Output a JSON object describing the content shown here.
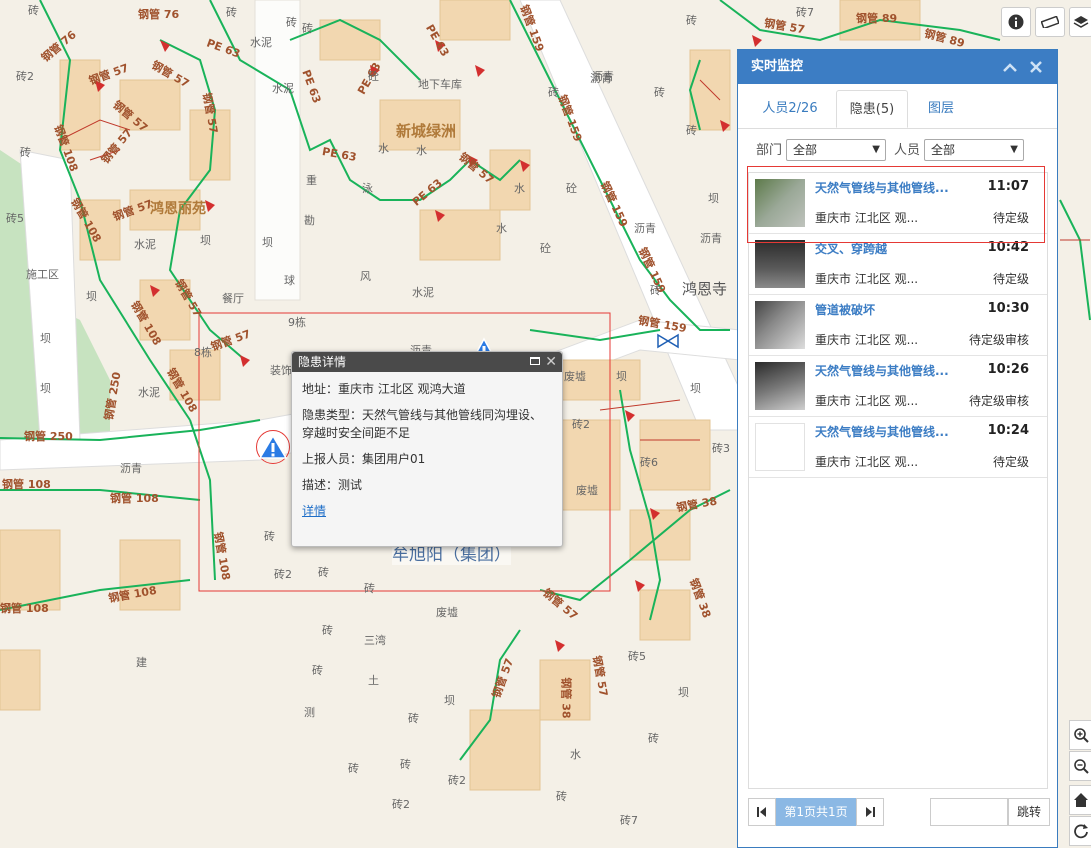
{
  "map": {
    "pipe_labels": [
      "钢管 76",
      "钢管 76",
      "钢管 57",
      "钢管 57",
      "钢管 57",
      "钢管 57",
      "钢管 108",
      "钢管 108",
      "钢管 57",
      "钢管 57",
      "钢管 108",
      "钢管 57",
      "钢管 108",
      "钢管 250",
      "钢管 250",
      "钢管 108",
      "钢管 108",
      "钢管 108",
      "钢管 108",
      "钢管 108",
      "钢管 57",
      "钢管 159",
      "钢管 159",
      "钢管 159",
      "钢管 159",
      "钢管 159",
      "钢管 89",
      "钢管 89",
      "钢管 57",
      "PE 63",
      "PE 63",
      "PE 63",
      "PE 63",
      "PE 63",
      "PE 63",
      "钢管 57",
      "钢管 38",
      "钢管 38",
      "钢管 57",
      "钢管 38",
      "钢管 57",
      "钢管 57"
    ],
    "place_labels": [
      "砖",
      "砖2",
      "砖",
      "砖",
      "砖",
      "水泥",
      "水泥",
      "砖",
      "砖5",
      "施工区",
      "坝",
      "坝",
      "坝",
      "坝",
      "坝",
      "水泥",
      "沥青",
      "水泥",
      "餐厅",
      "9栋",
      "8栋",
      "装饰",
      "重",
      "勘",
      "球",
      "风",
      "水泥",
      "砼",
      "地下车库",
      "水",
      "水",
      "泳",
      "水",
      "砼",
      "水",
      "砼",
      "沥青",
      "沥青",
      "砖",
      "坝",
      "沥青",
      "沥青",
      "废墟",
      "坝",
      "砖2",
      "砖6",
      "废墟",
      "坝",
      "砖3",
      "砖",
      "砖2",
      "砖",
      "砖",
      "废墟",
      "三湾",
      "砖",
      "土",
      "测",
      "砖",
      "建",
      "坝",
      "坝",
      "砖",
      "砖5",
      "水",
      "砖",
      "砖",
      "砖2",
      "砖2",
      "砖7",
      "砖",
      "砖",
      "砖7",
      "沥青",
      "砖",
      "砖",
      "砖",
      "砖"
    ],
    "area_names": {
      "xincheng": "新城绿洲",
      "hongen": "鸿恩丽苑",
      "hongensi": "鸿恩寺",
      "muxu": "牟旭阳（集团）"
    }
  },
  "toolbar": {
    "info_icon": "info-icon",
    "measure_icon": "ruler-icon",
    "layers_icon": "layers-icon"
  },
  "popup": {
    "title": "隐患详情",
    "address_label": "地址：",
    "address": "重庆市 江北区 观鸿大道",
    "type_label": "隐患类型：",
    "type": "天然气管线与其他管线同沟埋设、穿越时安全间距不足",
    "reporter_label": "上报人员：",
    "reporter": "集团用户01",
    "desc_label": "描述：",
    "desc": "测试",
    "detail_link": "详情"
  },
  "panel": {
    "title": "实时监控",
    "tabs": [
      {
        "label": "人员2/26"
      },
      {
        "label": "隐患(5)"
      },
      {
        "label": "图层"
      }
    ],
    "filters": {
      "dept_label": "部门",
      "dept_value": "全部",
      "person_label": "人员",
      "person_value": "全部"
    },
    "items": [
      {
        "title": "天然气管线与其他管线...",
        "time": "11:07",
        "address": "重庆市 江北区 观...",
        "status": "待定级"
      },
      {
        "title": "交叉、穿跨越",
        "time": "10:42",
        "address": "重庆市 江北区 观...",
        "status": "待定级"
      },
      {
        "title": "管道被破坏",
        "time": "10:30",
        "address": "重庆市 江北区 观...",
        "status": "待定级审核"
      },
      {
        "title": "天然气管线与其他管线...",
        "time": "10:26",
        "address": "重庆市 江北区 观...",
        "status": "待定级审核"
      },
      {
        "title": "天然气管线与其他管线...",
        "time": "10:24",
        "address": "重庆市 江北区 观...",
        "status": "待定级"
      }
    ],
    "pager": {
      "page_text": "第1页共1页",
      "jump_label": "跳转",
      "jump_value": ""
    }
  },
  "colors": {
    "panel_header": "#3c7dc4",
    "pipe_green": "#19b35a",
    "pipe_red": "#c0392b",
    "selection_red": "#e53935",
    "building": "#f2d7b0"
  }
}
